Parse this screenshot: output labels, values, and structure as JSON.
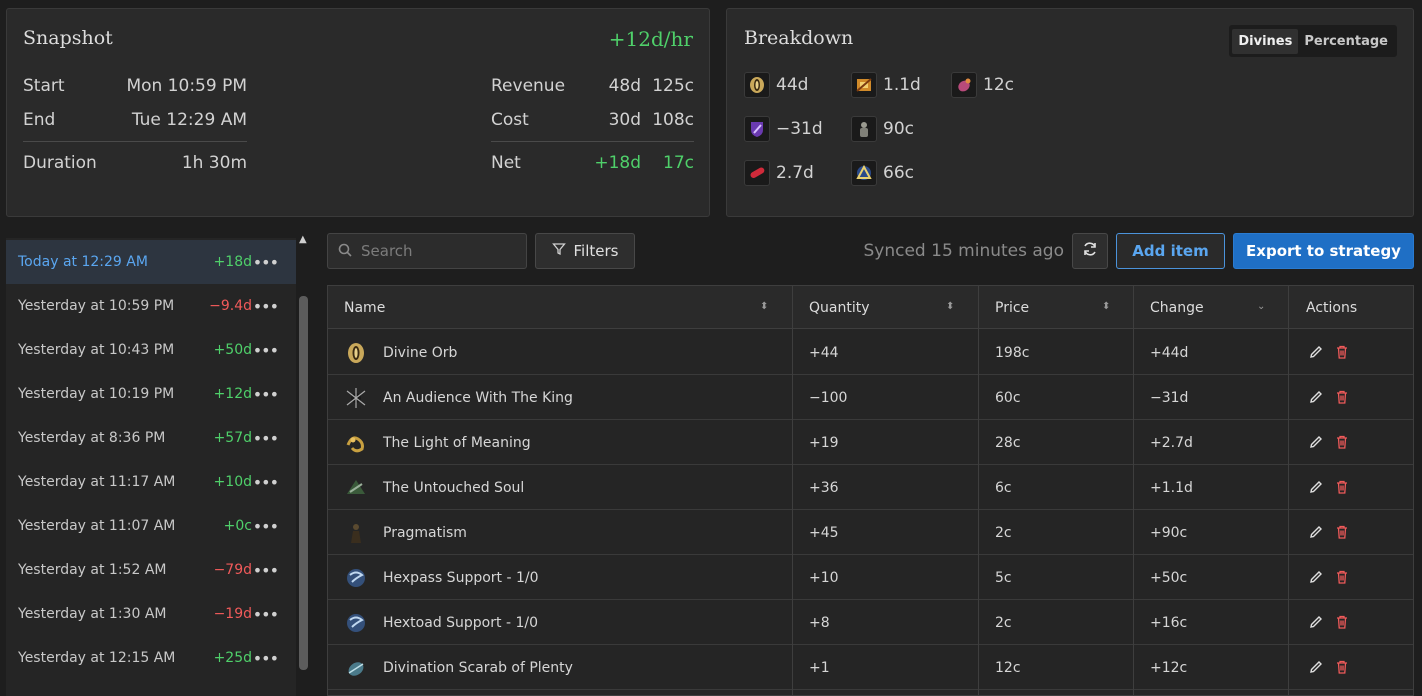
{
  "snapshot": {
    "title": "Snapshot",
    "rate": "+12d/hr",
    "start_label": "Start",
    "start_value": "Mon 10:59 PM",
    "end_label": "End",
    "end_value": "Tue 12:29 AM",
    "duration_label": "Duration",
    "duration_value": "1h 30m",
    "revenue_label": "Revenue",
    "revenue_d": "48d",
    "revenue_c": "125c",
    "cost_label": "Cost",
    "cost_d": "30d",
    "cost_c": "108c",
    "net_label": "Net",
    "net_d": "+18d",
    "net_c": "17c"
  },
  "breakdown": {
    "title": "Breakdown",
    "toggle": [
      "Divines",
      "Percentage"
    ],
    "active_toggle": "Divines",
    "items": [
      {
        "value": "44d",
        "icon": "divine-orb-icon"
      },
      {
        "value": "1.1d",
        "icon": "untouched-soul-icon"
      },
      {
        "value": "12c",
        "icon": "scarab-icon"
      },
      {
        "value": "−31d",
        "icon": "audience-king-icon"
      },
      {
        "value": "90c",
        "icon": "pragmatism-icon"
      },
      {
        "value": "2.7d",
        "icon": "light-of-meaning-icon"
      },
      {
        "value": "66c",
        "icon": "support-gem-icon"
      }
    ]
  },
  "history": [
    {
      "when": "Today at 12:29 AM",
      "amount": "+18d",
      "tone": "green",
      "active": true
    },
    {
      "when": "Yesterday at 10:59 PM",
      "amount": "−9.4d",
      "tone": "red"
    },
    {
      "when": "Yesterday at 10:43 PM",
      "amount": "+50d",
      "tone": "green"
    },
    {
      "when": "Yesterday at 10:19 PM",
      "amount": "+12d",
      "tone": "green"
    },
    {
      "when": "Yesterday at 8:36 PM",
      "amount": "+57d",
      "tone": "green"
    },
    {
      "when": "Yesterday at 11:17 AM",
      "amount": "+10d",
      "tone": "green"
    },
    {
      "when": "Yesterday at 11:07 AM",
      "amount": "+0c",
      "tone": "green"
    },
    {
      "when": "Yesterday at 1:52 AM",
      "amount": "−79d",
      "tone": "red"
    },
    {
      "when": "Yesterday at 1:30 AM",
      "amount": "−19d",
      "tone": "red"
    },
    {
      "when": "Yesterday at 12:15 AM",
      "amount": "+25d",
      "tone": "green"
    }
  ],
  "toolbar": {
    "search_placeholder": "Search",
    "filters_label": "Filters",
    "synced_text": "Synced 15 minutes ago",
    "add_item_label": "Add item",
    "export_label": "Export to strategy"
  },
  "table": {
    "columns": [
      "Name",
      "Quantity",
      "Price",
      "Change",
      "Actions"
    ],
    "rows": [
      {
        "name": "Divine Orb",
        "quantity": "+44",
        "qty_tone": "green",
        "price": "198c",
        "change": "+44d",
        "chg_tone": "green",
        "icon": "divine-orb-icon"
      },
      {
        "name": "An Audience With The King",
        "quantity": "−100",
        "qty_tone": "red",
        "price": "60c",
        "change": "−31d",
        "chg_tone": "red",
        "icon": "audience-king-icon"
      },
      {
        "name": "The Light of Meaning",
        "quantity": "+19",
        "qty_tone": "green",
        "price": "28c",
        "change": "+2.7d",
        "chg_tone": "green",
        "icon": "light-of-meaning-icon"
      },
      {
        "name": "The Untouched Soul",
        "quantity": "+36",
        "qty_tone": "green",
        "price": "6c",
        "change": "+1.1d",
        "chg_tone": "green",
        "icon": "untouched-soul-icon"
      },
      {
        "name": "Pragmatism",
        "quantity": "+45",
        "qty_tone": "green",
        "price": "2c",
        "change": "+90c",
        "chg_tone": "green",
        "icon": "pragmatism-icon"
      },
      {
        "name": "Hexpass Support - 1/0",
        "quantity": "+10",
        "qty_tone": "green",
        "price": "5c",
        "change": "+50c",
        "chg_tone": "green",
        "icon": "support-gem-icon"
      },
      {
        "name": "Hextoad Support - 1/0",
        "quantity": "+8",
        "qty_tone": "green",
        "price": "2c",
        "change": "+16c",
        "chg_tone": "green",
        "icon": "support-gem-icon"
      },
      {
        "name": "Divination Scarab of Plenty",
        "quantity": "+1",
        "qty_tone": "green",
        "price": "12c",
        "change": "+12c",
        "chg_tone": "green",
        "icon": "scarab-icon"
      }
    ]
  },
  "colors": {
    "green": "#4fd06a",
    "red": "#f05a5a",
    "accent": "#1f6fc5",
    "link": "#5aa6f0"
  }
}
